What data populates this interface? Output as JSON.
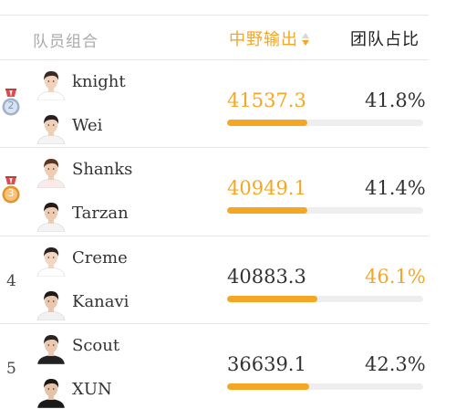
{
  "header": {
    "combo_label": "队员组合",
    "damage_label": "中野输出",
    "share_label": "团队占比"
  },
  "colors": {
    "accent": "#f5a623",
    "text": "#333333",
    "muted": "#aaaaaa",
    "divider": "#e6e6e6",
    "track": "#eeeeee"
  },
  "rows": [
    {
      "rank": "2",
      "medal": "silver-medal-icon",
      "players": [
        "knight",
        "Wei"
      ],
      "damage": "41537.3",
      "share": "41.8%",
      "bar_fraction": 0.41,
      "damage_highlight": true,
      "share_highlight": false
    },
    {
      "rank": "3",
      "medal": "bronze-medal-icon",
      "players": [
        "Shanks",
        "Tarzan"
      ],
      "damage": "40949.1",
      "share": "41.4%",
      "bar_fraction": 0.41,
      "damage_highlight": true,
      "share_highlight": false
    },
    {
      "rank": "4",
      "medal": "",
      "players": [
        "Creme",
        "Kanavi"
      ],
      "damage": "40883.3",
      "share": "46.1%",
      "bar_fraction": 0.46,
      "damage_highlight": false,
      "share_highlight": true
    },
    {
      "rank": "5",
      "medal": "",
      "players": [
        "Scout",
        "XUN"
      ],
      "damage": "36639.1",
      "share": "42.3%",
      "bar_fraction": 0.42,
      "damage_highlight": false,
      "share_highlight": false
    }
  ]
}
